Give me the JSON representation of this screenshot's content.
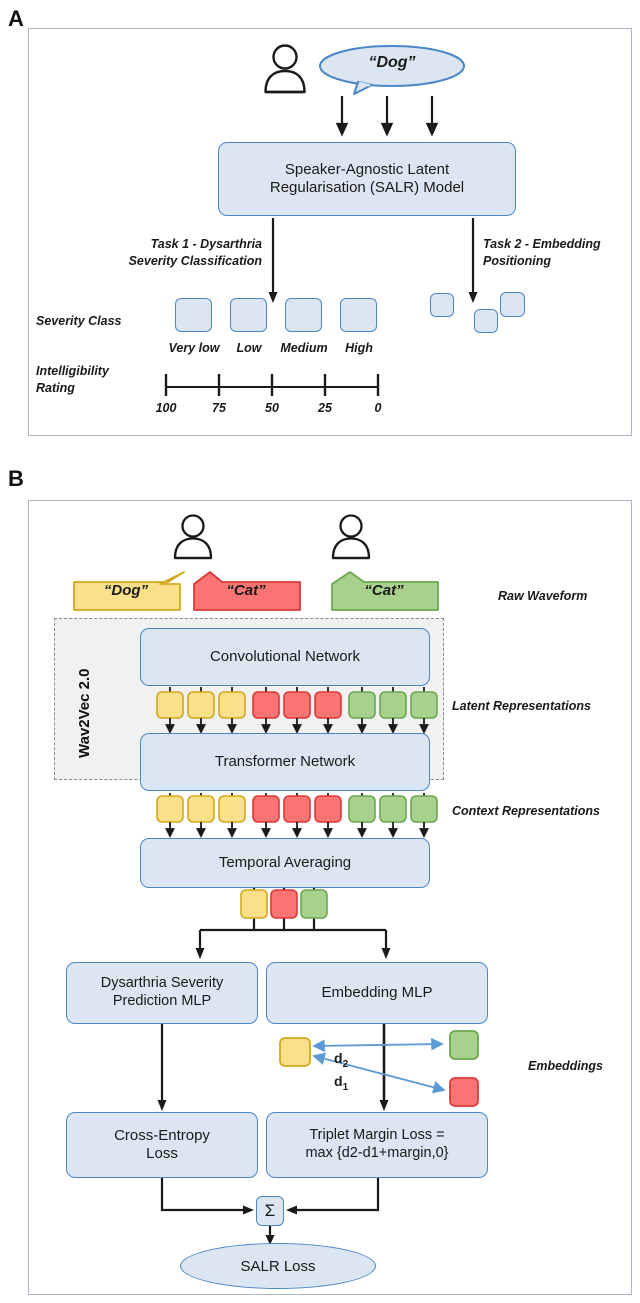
{
  "figure": {
    "panels": [
      {
        "letter": "A"
      },
      {
        "letter": "B"
      }
    ]
  },
  "panel_a": {
    "letter": "A",
    "speech_bubble": "“Dog”",
    "model_box": "Speaker-Agnostic Latent Regularisation (SALR) Model",
    "model_box_line1": "Speaker-Agnostic Latent",
    "model_box_line2": "Regularisation (SALR) Model",
    "task1_line1": "Task 1 - Dysarthria",
    "task1_line2": "Severity Classification",
    "task2_line1": "Task 2 - Embedding",
    "task2_line2": "Positioning",
    "severity_class_label": "Severity Class",
    "intelligibility_label_line1": "Intelligibility",
    "intelligibility_label_line2": "Rating",
    "severity_classes": [
      "Very low",
      "Low",
      "Medium",
      "High"
    ],
    "rating_ticks": [
      "100",
      "75",
      "50",
      "25",
      "0"
    ],
    "embedding_squares": 3
  },
  "panel_b": {
    "letter": "B",
    "speakers": 2,
    "waveforms": [
      {
        "label": "“Dog”",
        "color": "yellow"
      },
      {
        "label": "“Cat”",
        "color": "red"
      },
      {
        "label": "“Cat”",
        "color": "green"
      }
    ],
    "wav2vec_label": "Wav2Vec 2.0",
    "conv_network": "Convolutional Network",
    "transformer_network": "Transformer Network",
    "temporal_averaging": "Temporal Averaging",
    "annotations": {
      "raw_waveform": "Raw Waveform",
      "latent_representations": "Latent Representations",
      "context_representations": "Context Representations",
      "embeddings": "Embeddings"
    },
    "latent_tokens": [
      "yellow",
      "yellow",
      "yellow",
      "red",
      "red",
      "red",
      "green",
      "green",
      "green"
    ],
    "context_tokens": [
      "yellow",
      "yellow",
      "yellow",
      "red",
      "red",
      "red",
      "green",
      "green",
      "green"
    ],
    "pooled_tokens": [
      "yellow",
      "red",
      "green"
    ],
    "severity_mlp_line1": "Dysarthria Severity",
    "severity_mlp_line2": "Prediction MLP",
    "embedding_mlp": "Embedding MLP",
    "distance_labels": {
      "d2": "d",
      "d2_sub": "2",
      "d1": "d",
      "d1_sub": "1"
    },
    "cross_entropy_line1": "Cross-Entropy",
    "cross_entropy_line2": "Loss",
    "triplet_line1": "Triplet Margin Loss =",
    "triplet_line2": "max {d2-d1+margin,0}",
    "sum_symbol": "Σ",
    "salr_loss": "SALR Loss"
  },
  "colors": {
    "blue_fill": "#dce6f2",
    "blue_border": "#4a86c8",
    "yellow_fill": "#fbe08a",
    "yellow_border": "#d3a81f",
    "red_fill": "#fb7474",
    "red_border": "#d83a3a",
    "green_fill": "#a9d18e",
    "green_border": "#6aa84f",
    "arrow": "#1a1a1a",
    "panel_border": "#aeb6c4",
    "embedding_arrow": "#4a86c8"
  }
}
